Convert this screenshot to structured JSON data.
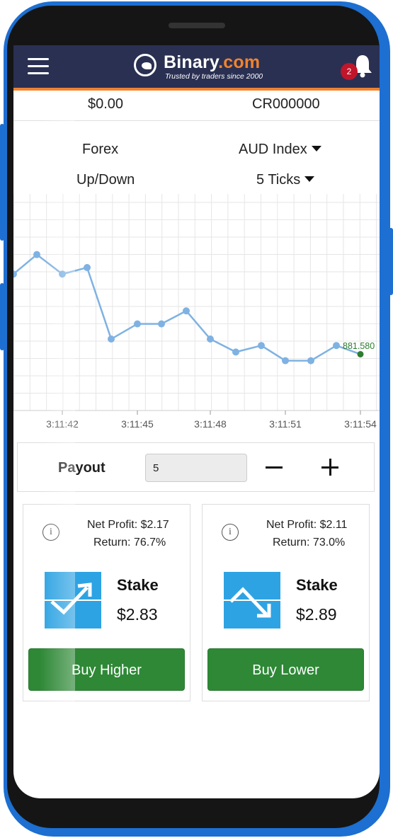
{
  "header": {
    "brand_name": "Binary",
    "brand_suffix": ".com",
    "tagline": "Trusted by traders since 2000",
    "notification_count": "2"
  },
  "account": {
    "balance": "$0.00",
    "account_id": "CR000000"
  },
  "selectors": {
    "market": "Forex",
    "symbol": "AUD Index",
    "contract_type": "Up/Down",
    "duration": "5 Ticks"
  },
  "chart_data": {
    "type": "line",
    "x": [
      "3:11:41",
      "3:11:42",
      "3:11:43",
      "3:11:44",
      "3:11:45",
      "3:11:46",
      "3:11:47",
      "3:11:48",
      "3:11:49",
      "3:11:50",
      "3:11:51",
      "3:11:52",
      "3:11:53",
      "3:11:54"
    ],
    "tick_labels": [
      "3:11:42",
      "3:11:45",
      "3:11:48",
      "3:11:51",
      "3:11:54"
    ],
    "values": [
      6.3,
      7.2,
      6.3,
      6.6,
      3.3,
      4.0,
      4.0,
      4.6,
      3.3,
      2.7,
      3.0,
      2.3,
      2.3,
      3.0,
      2.6
    ],
    "last_value_label": "881.580",
    "grid": true,
    "colors": {
      "line": "#7fb2e2",
      "last_point": "#2e7d32",
      "label": "#2e7d32",
      "grid": "#e6e6e6"
    }
  },
  "payout": {
    "label": "Payout",
    "value": "5"
  },
  "contracts": [
    {
      "net_profit": "Net Profit: $2.17",
      "return": "Return: 76.7%",
      "stake_label": "Stake",
      "stake_value": "$2.83",
      "button": "Buy Higher",
      "direction": "up"
    },
    {
      "net_profit": "Net Profit: $2.11",
      "return": "Return: 73.0%",
      "stake_label": "Stake",
      "stake_value": "$2.89",
      "button": "Buy Lower",
      "direction": "down"
    }
  ],
  "colors": {
    "header_bg": "#2a3052",
    "accent": "#f0832f",
    "buy_green": "#2e8836",
    "trend_blue": "#2ea3e3",
    "phone_frame": "#1d6fd1"
  }
}
